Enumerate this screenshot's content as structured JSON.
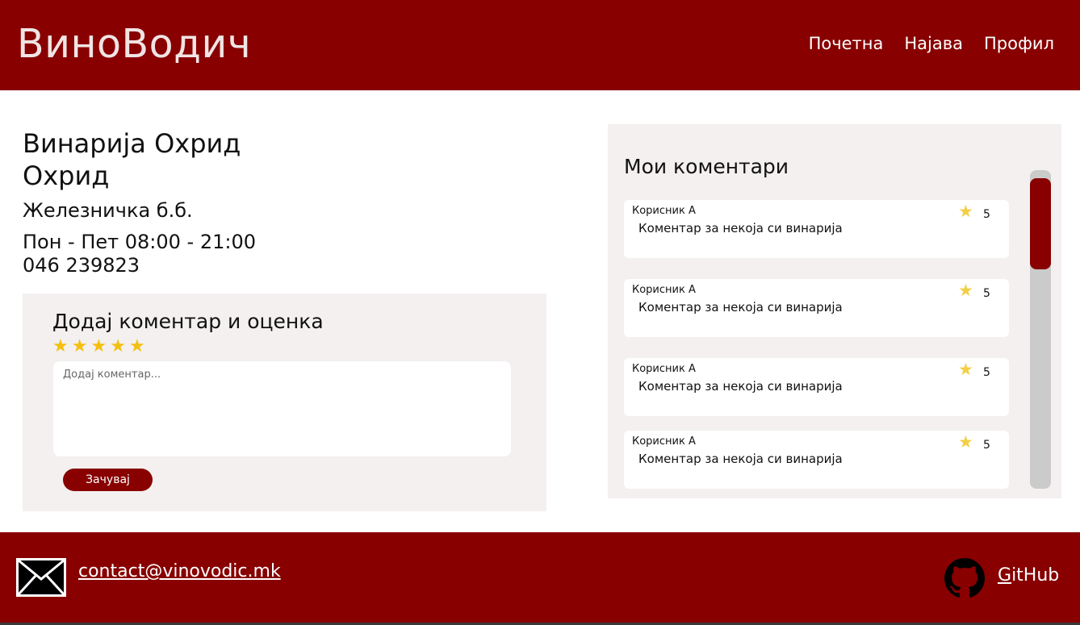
{
  "header": {
    "brand": "ВиноВодич",
    "nav": [
      "Почетна",
      "Најава",
      "Профил"
    ]
  },
  "winery": {
    "name": "Винарија Охрид",
    "city": "Охрид",
    "address": "Железничка б.б.",
    "hours": "Пон - Пет 08:00 - 21:00",
    "phone": "046 239823"
  },
  "add_comment": {
    "title": "Додај коментар и оценка",
    "stars": 5,
    "placeholder": "Додај коментар...",
    "save_label": "Зачувај"
  },
  "comments": {
    "title": "Мои коментари",
    "items": [
      {
        "user": "Корисник А",
        "score": "5",
        "text": "Коментар за некоја си винарија"
      },
      {
        "user": "Корисник А",
        "score": "5",
        "text": "Коментар за некоја си винарија"
      },
      {
        "user": "Корисник А",
        "score": "5",
        "text": "Коментар за некоја си винарија"
      },
      {
        "user": "Корисник А",
        "score": "5",
        "text": "Коментар за некоја си винарија"
      }
    ]
  },
  "footer": {
    "email": "contact@vinovodic.mk",
    "github_first": "G",
    "github_rest": "itHub"
  },
  "colors": {
    "brand": "#880000",
    "panel": "#f3f0ef",
    "star": "#f5bf0f"
  }
}
